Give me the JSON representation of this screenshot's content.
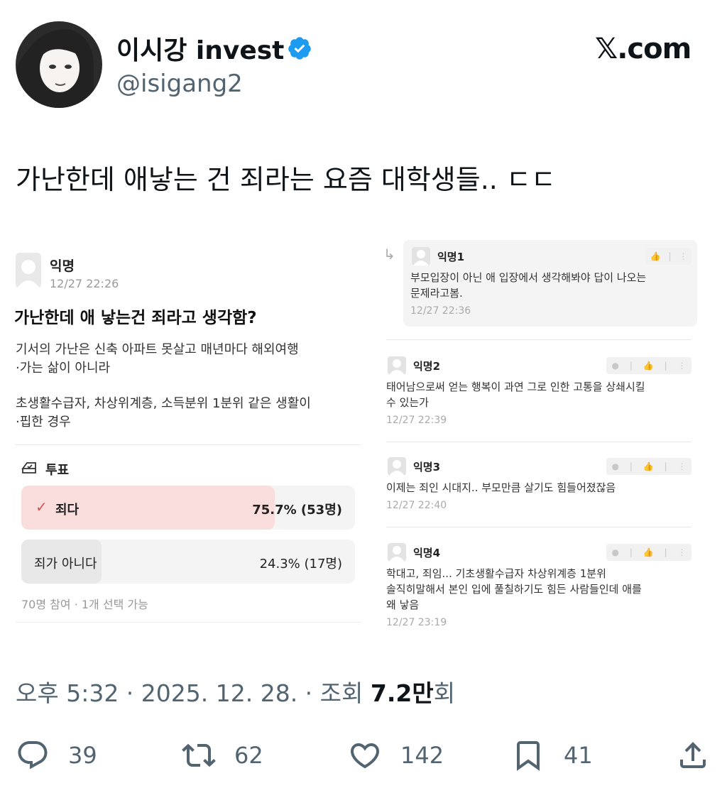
{
  "author": {
    "name": "이시강 invest",
    "handle": "@isigang2",
    "verified_icon": "verified-badge-icon",
    "verified_color": "#1d9bf0"
  },
  "brand": {
    "logo_text": "𝕏.com"
  },
  "tweet": {
    "text": "가난한데 애낳는 건 죄라는 요즘 대학생들.. ㄷㄷ"
  },
  "embedded_post": {
    "author": "익명",
    "date": "12/27 22:26",
    "title": "가난한데 애 낳는건 죄라고 생각함?",
    "body": [
      "기서의 가난은 신축 아파트 못살고 매년마다 해외여행",
      "·가는 삶이 아니라",
      "초생활수급자, 차상위계층, 소득분위 1분위 같은 생활이",
      "·핍한 경우"
    ],
    "poll": {
      "label": "투표",
      "options": [
        {
          "label": "죄다",
          "value": "75.7% (53명)",
          "percent": 75.7,
          "selected": true
        },
        {
          "label": "죄가 아니다",
          "value": "24.3% (17명)",
          "percent": 24.3,
          "selected": false
        }
      ],
      "meta": "70명 참여 · 1개 선택 가능",
      "accent": "#fadede"
    }
  },
  "comments": [
    {
      "name": "익명1",
      "lines": [
        "부모입장이 아닌 애 입장에서 생각해봐야 답이 나오는",
        "문제라고봄."
      ],
      "date": "12/27 22:36",
      "reply": true
    },
    {
      "name": "익명2",
      "lines": [
        "태어남으로써 얻는 행복이 과연 그로 인한 고통을 상쇄시킬",
        "수 있는가"
      ],
      "date": "12/27 22:39",
      "reply": false
    },
    {
      "name": "익명3",
      "lines": [
        "이제는 죄인 시대지.. 부모만큼 살기도 힘들어졌잖음"
      ],
      "date": "12/27 22:40",
      "reply": false
    },
    {
      "name": "익명4",
      "lines": [
        "학대고, 죄임... 기초생활수급자 차상위계층 1분위",
        "솔직히말해서 본인 입에 풀칠하기도 힘든 사람들인데 애를",
        "왜 낳음"
      ],
      "date": "12/27 23:19",
      "reply": false
    }
  ],
  "meta": {
    "prefix": "오후 5:32 · 2025. 12. 28. · 조회 ",
    "views": "7.2만",
    "suffix": "회"
  },
  "actions": {
    "replies": "39",
    "reposts": "62",
    "likes": "142",
    "bookmarks": "41"
  }
}
